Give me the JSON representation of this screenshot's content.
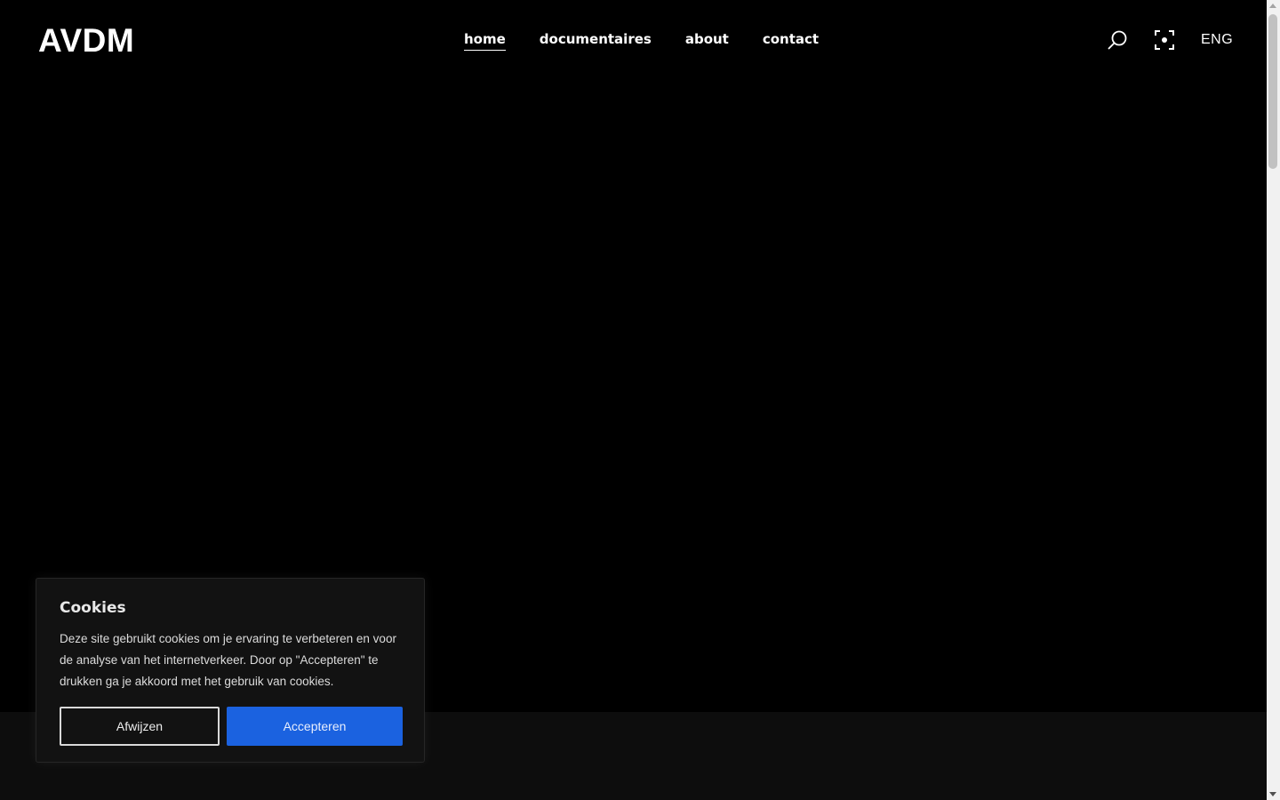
{
  "header": {
    "logo": "AVDM",
    "nav": [
      {
        "label": "home",
        "active": true
      },
      {
        "label": "documentaires",
        "active": false
      },
      {
        "label": "about",
        "active": false
      },
      {
        "label": "contact",
        "active": false
      }
    ],
    "search_icon": "search-icon",
    "focus_icon": "focus-mode-icon",
    "language": "ENG"
  },
  "cookie_banner": {
    "title": "Cookies",
    "text": "Deze site gebruikt cookies om je ervaring te verbeteren en voor de analyse van het internetverkeer. Door op \"Accepteren\" te drukken ga je akkoord met het gebruik van cookies.",
    "reject_label": "Afwijzen",
    "accept_label": "Accepteren"
  },
  "colors": {
    "background": "#000000",
    "footer_band": "#0d0d0d",
    "accent": "#1b62e0",
    "text": "#ffffff"
  }
}
